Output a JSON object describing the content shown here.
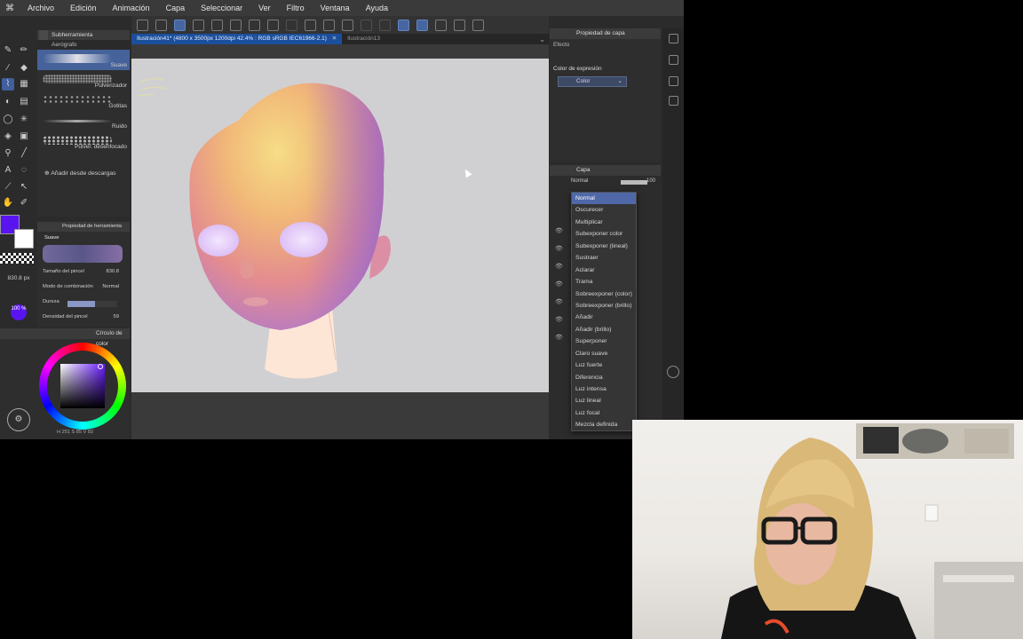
{
  "menu": {
    "logo": "⌘",
    "items": [
      "Archivo",
      "Edición",
      "Animación",
      "Capa",
      "Seleccionar",
      "Ver",
      "Filtro",
      "Ventana",
      "Ayuda"
    ]
  },
  "tabs": {
    "active_doc": "Ilustración41* (4800 x 3500px 1200dpi 42.4% : RGB sRGB IEC61966-2.1)",
    "close": "✕",
    "other_doc": "Ilustración13"
  },
  "subtool": {
    "title": "Subherramienta",
    "group": "Aerógrafo",
    "brushes": [
      {
        "name": "Suave"
      },
      {
        "name": "Pulverizador"
      },
      {
        "name": "Gotitas"
      },
      {
        "name": "Ruido"
      },
      {
        "name": "Pulver. desenfocado"
      }
    ],
    "add_downloads": "Añadir desde descargas"
  },
  "toolprop": {
    "title": "Propiedad de herramienta",
    "brush_preview_label": "Suave",
    "rows": [
      {
        "key": "Tamaño del pincel",
        "value": "830.8"
      },
      {
        "key": "Modo de combinación",
        "value": "Normal"
      },
      {
        "key": "Dureza",
        "value": ""
      },
      {
        "key": "Densidad del pincel",
        "value": "59"
      }
    ],
    "hardness_level": 0.55,
    "size_display": "830.8 px",
    "opacity_display": "100 %"
  },
  "colorwheel": {
    "title": "Círculo de color",
    "values": "H 251 S 85 V 82",
    "main_color": "#5a14f0",
    "sub_color": "#ffffff"
  },
  "rightprop": {
    "title": "Propiedad de capa",
    "effect": "Efecto",
    "expression_label": "Color de expresión",
    "expression_value": "Color"
  },
  "layers": {
    "title": "Capa",
    "blend_current": "Normal",
    "opacity": "100"
  },
  "blend_menu": {
    "selected_index": 0,
    "options": [
      "Normal",
      "Oscurecer",
      "Multiplicar",
      "Subexponer color",
      "Subexponer (lineal)",
      "Sustraer",
      "Aclarar",
      "Trama",
      "Sobreexponer (color)",
      "Sobreexponer (brillo)",
      "Añadir",
      "Añadir (brillo)",
      "Superponer",
      "Claro suave",
      "Luz fuerte",
      "Diferencia",
      "Luz intensa",
      "Luz lineal",
      "Luz focal",
      "Mezcla definida"
    ]
  },
  "accent_color": "#4a6fb5"
}
